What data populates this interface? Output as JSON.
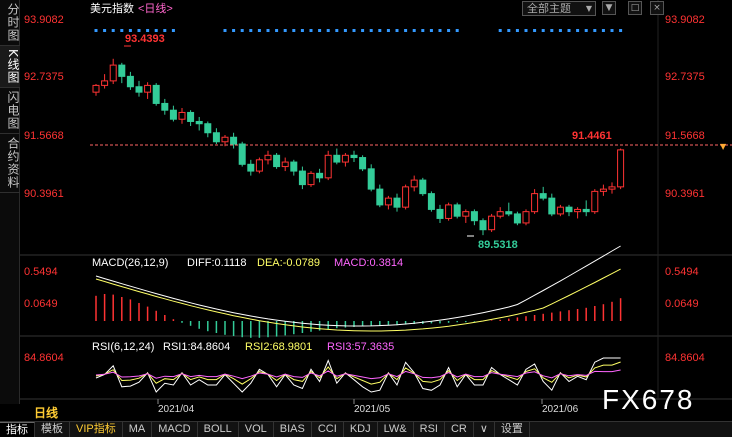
{
  "side_tabs": [
    "分时图",
    "K线图",
    "闪电图",
    "合约资料"
  ],
  "header": {
    "title": "美元指数",
    "period": "<日线>",
    "theme_dropdown": "全部主题",
    "dropdown_arrow": "▼",
    "btn_square": "□",
    "btn_close": "×"
  },
  "price_axis": [
    "93.9082",
    "92.7375",
    "91.5668",
    "90.3961"
  ],
  "annotations": {
    "high": "93.4393",
    "low": "89.5318",
    "last": "91.4461"
  },
  "macd": {
    "label": "MACD(26,12,9)",
    "diff": "DIFF:0.1118",
    "dea": "DEA:-0.0789",
    "macd": "MACD:0.3814",
    "axis": [
      "0.5494",
      "0.0649"
    ]
  },
  "rsi": {
    "label": "RSI(6,12,24)",
    "rsi1": "RSI1:84.8604",
    "rsi2": "RSI2:68.9801",
    "rsi3": "RSI3:57.3635",
    "axis": [
      "84.8604"
    ]
  },
  "dates": [
    "2021/04",
    "2021/05",
    "2021/06"
  ],
  "period_label": "日线",
  "bottom_tabs": [
    "指标",
    "模板",
    "VIP指标",
    "MA",
    "MACD",
    "BOLL",
    "VOL",
    "BIAS",
    "CCI",
    "KDJ",
    "LW&",
    "RSI",
    "CR",
    "∨",
    "设置"
  ],
  "watermark": "FX678",
  "colors": {
    "up": "#ff3333",
    "down": "#33cc99",
    "axis_text": "#ff3333",
    "diff_line": "#ffffff",
    "dea_line": "#ffff66",
    "rsi1_line": "#ffffff",
    "rsi2_line": "#ffff66",
    "rsi3_line": "#ff66ff",
    "dot_marker": "#3399ff",
    "last_price_line": "#ff6666"
  },
  "chart_data": {
    "type": "candlestick",
    "price_range": [
      89.2,
      94.3
    ],
    "candles": [
      [
        92.7,
        92.88,
        92.62,
        92.85
      ],
      [
        92.85,
        93.1,
        92.78,
        92.95
      ],
      [
        92.95,
        93.44,
        92.88,
        93.3
      ],
      [
        93.3,
        93.35,
        92.9,
        93.05
      ],
      [
        93.05,
        93.15,
        92.75,
        92.82
      ],
      [
        92.82,
        92.95,
        92.6,
        92.7
      ],
      [
        92.7,
        92.92,
        92.55,
        92.85
      ],
      [
        92.85,
        92.9,
        92.4,
        92.45
      ],
      [
        92.45,
        92.55,
        92.2,
        92.3
      ],
      [
        92.3,
        92.4,
        92.05,
        92.1
      ],
      [
        92.1,
        92.35,
        92.0,
        92.25
      ],
      [
        92.25,
        92.3,
        91.95,
        92.05
      ],
      [
        92.05,
        92.15,
        91.85,
        92.0
      ],
      [
        92.0,
        92.05,
        91.7,
        91.8
      ],
      [
        91.8,
        91.9,
        91.55,
        91.6
      ],
      [
        91.6,
        91.75,
        91.5,
        91.7
      ],
      [
        91.7,
        91.8,
        91.45,
        91.55
      ],
      [
        91.55,
        91.6,
        91.05,
        91.1
      ],
      [
        91.1,
        91.2,
        90.85,
        90.95
      ],
      [
        90.95,
        91.25,
        90.9,
        91.2
      ],
      [
        91.2,
        91.4,
        91.1,
        91.3
      ],
      [
        91.3,
        91.35,
        91.0,
        91.05
      ],
      [
        91.05,
        91.25,
        90.95,
        91.15
      ],
      [
        91.15,
        91.2,
        90.85,
        90.95
      ],
      [
        90.95,
        91.05,
        90.55,
        90.65
      ],
      [
        90.65,
        90.95,
        90.6,
        90.9
      ],
      [
        90.9,
        91.0,
        90.7,
        90.8
      ],
      [
        90.8,
        91.4,
        90.75,
        91.3
      ],
      [
        91.3,
        91.45,
        91.1,
        91.15
      ],
      [
        91.15,
        91.35,
        91.05,
        91.3
      ],
      [
        91.3,
        91.4,
        91.15,
        91.25
      ],
      [
        91.25,
        91.3,
        90.95,
        91.0
      ],
      [
        91.0,
        91.1,
        90.5,
        90.55
      ],
      [
        90.55,
        90.65,
        90.15,
        90.2
      ],
      [
        90.2,
        90.4,
        90.1,
        90.35
      ],
      [
        90.35,
        90.45,
        90.05,
        90.15
      ],
      [
        90.15,
        90.65,
        90.1,
        90.6
      ],
      [
        90.6,
        90.85,
        90.5,
        90.75
      ],
      [
        90.75,
        90.8,
        90.4,
        90.45
      ],
      [
        90.45,
        90.5,
        90.05,
        90.1
      ],
      [
        90.1,
        90.2,
        89.8,
        89.9
      ],
      [
        89.9,
        90.25,
        89.85,
        90.2
      ],
      [
        90.2,
        90.25,
        89.9,
        89.95
      ],
      [
        89.95,
        90.1,
        89.8,
        90.05
      ],
      [
        90.05,
        90.1,
        89.75,
        89.85
      ],
      [
        89.85,
        89.9,
        89.53,
        89.65
      ],
      [
        89.65,
        90.0,
        89.6,
        89.95
      ],
      [
        89.95,
        90.15,
        89.9,
        90.05
      ],
      [
        90.05,
        90.25,
        89.95,
        90.0
      ],
      [
        90.0,
        90.05,
        89.75,
        89.8
      ],
      [
        89.8,
        90.1,
        89.75,
        90.05
      ],
      [
        90.05,
        90.55,
        90.0,
        90.45
      ],
      [
        90.45,
        90.6,
        90.3,
        90.35
      ],
      [
        90.35,
        90.45,
        89.95,
        90.0
      ],
      [
        90.0,
        90.2,
        89.95,
        90.15
      ],
      [
        90.15,
        90.2,
        89.95,
        90.05
      ],
      [
        90.05,
        90.15,
        89.9,
        90.1
      ],
      [
        90.1,
        90.3,
        89.95,
        90.05
      ],
      [
        90.05,
        90.55,
        90.0,
        90.5
      ],
      [
        90.5,
        90.65,
        90.4,
        90.55
      ],
      [
        90.55,
        90.7,
        90.45,
        90.6
      ],
      [
        90.6,
        91.45,
        90.55,
        91.42
      ]
    ],
    "macd_values": [
      0.42,
      0.45,
      0.44,
      0.4,
      0.36,
      0.3,
      0.24,
      0.17,
      0.1,
      0.03,
      -0.03,
      -0.08,
      -0.13,
      -0.17,
      -0.2,
      -0.23,
      -0.25,
      -0.27,
      -0.28,
      -0.28,
      -0.27,
      -0.26,
      -0.24,
      -0.22,
      -0.2,
      -0.18,
      -0.16,
      -0.14,
      -0.12,
      -0.11,
      -0.1,
      -0.09,
      -0.08,
      -0.08,
      -0.07,
      -0.07,
      -0.06,
      -0.05,
      -0.05,
      -0.04,
      -0.04,
      -0.03,
      -0.02,
      -0.02,
      -0.01,
      0.0,
      0.01,
      0.02,
      0.04,
      0.06,
      0.08,
      0.1,
      0.12,
      0.14,
      0.16,
      0.18,
      0.2,
      0.22,
      0.25,
      0.28,
      0.32,
      0.38
    ],
    "dates": [
      "2021/04",
      "2021/05",
      "2021/06"
    ]
  }
}
